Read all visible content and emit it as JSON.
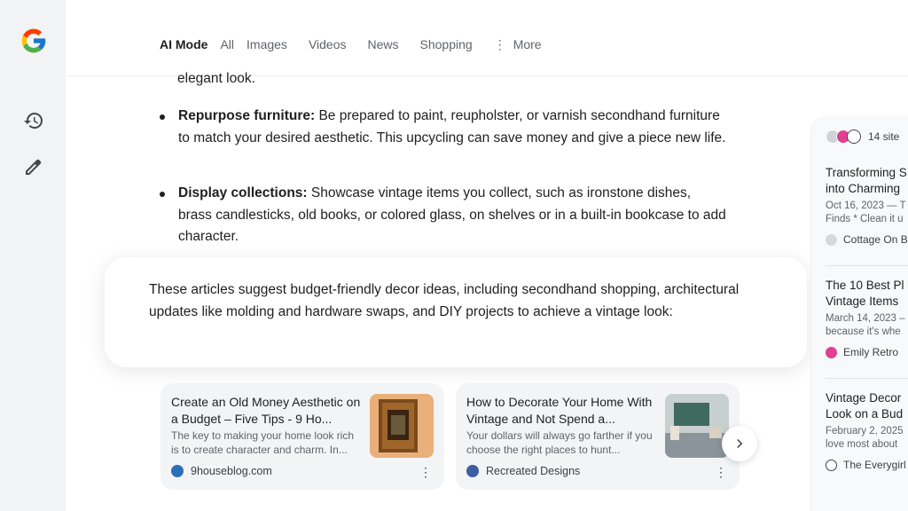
{
  "header": {
    "tabs": [
      {
        "label": "AI Mode"
      },
      {
        "label": "All"
      },
      {
        "label": "Images"
      },
      {
        "label": "Videos"
      },
      {
        "label": "News"
      },
      {
        "label": "Shopping"
      }
    ],
    "more_label": "More"
  },
  "rail": {
    "icons": [
      "google-logo",
      "history-icon",
      "new-chat-icon"
    ]
  },
  "content": {
    "fade_line": "elegant look.",
    "bullets": [
      {
        "bold": "Repurpose furniture:",
        "text": " Be prepared to paint, reupholster, or varnish secondhand furniture to match your desired aesthetic. This upcycling can save money and give a piece new life."
      },
      {
        "bold": "Display collections:",
        "text": " Showcase vintage items you collect, such as ironstone dishes, brass candlesticks, old books, or colored glass, on shelves or in a built-in bookcase to add character."
      }
    ],
    "summary": "These articles suggest budget-friendly decor ideas, including secondhand shopping, architectural updates like molding and hardware swaps, and DIY projects to achieve a vintage look:"
  },
  "articles": [
    {
      "title": "Create an Old Money Aesthetic on a Budget – Five Tips - 9 Ho...",
      "snippet": "The key to making your home look rich is to create character and charm. In...",
      "source": "9houseblog.com",
      "source_color": "#2c6fb6"
    },
    {
      "title": "How to Decorate Your Home With Vintage and Not Spend a...",
      "snippet": "Your dollars will always go farther if you choose the right places to hunt...",
      "source": "Recreated Designs",
      "source_color": "#3b5fa0"
    }
  ],
  "right_panel": {
    "sites_count": "14 site",
    "items": [
      {
        "title1": "Transforming S",
        "title2": "into Charming",
        "snippet1": "Oct 16, 2023 — T",
        "snippet2": "Finds * Clean it u",
        "source": "Cottage On B"
      },
      {
        "title1": "The 10 Best Pl",
        "title2": "Vintage Items",
        "snippet1": "March 14, 2023 –",
        "snippet2": "because it's whe",
        "source": "Emily Retro"
      },
      {
        "title1": "Vintage Decor",
        "title2": "Look on a Bud",
        "snippet1": "February 2, 2025",
        "snippet2": "love most about",
        "source": "The Everygirl"
      }
    ]
  },
  "colors": {
    "accent_pink": "#e0408f",
    "text_primary": "#1f1f1f",
    "text_secondary": "#5f6368",
    "rail_bg": "#f1f3f4"
  }
}
